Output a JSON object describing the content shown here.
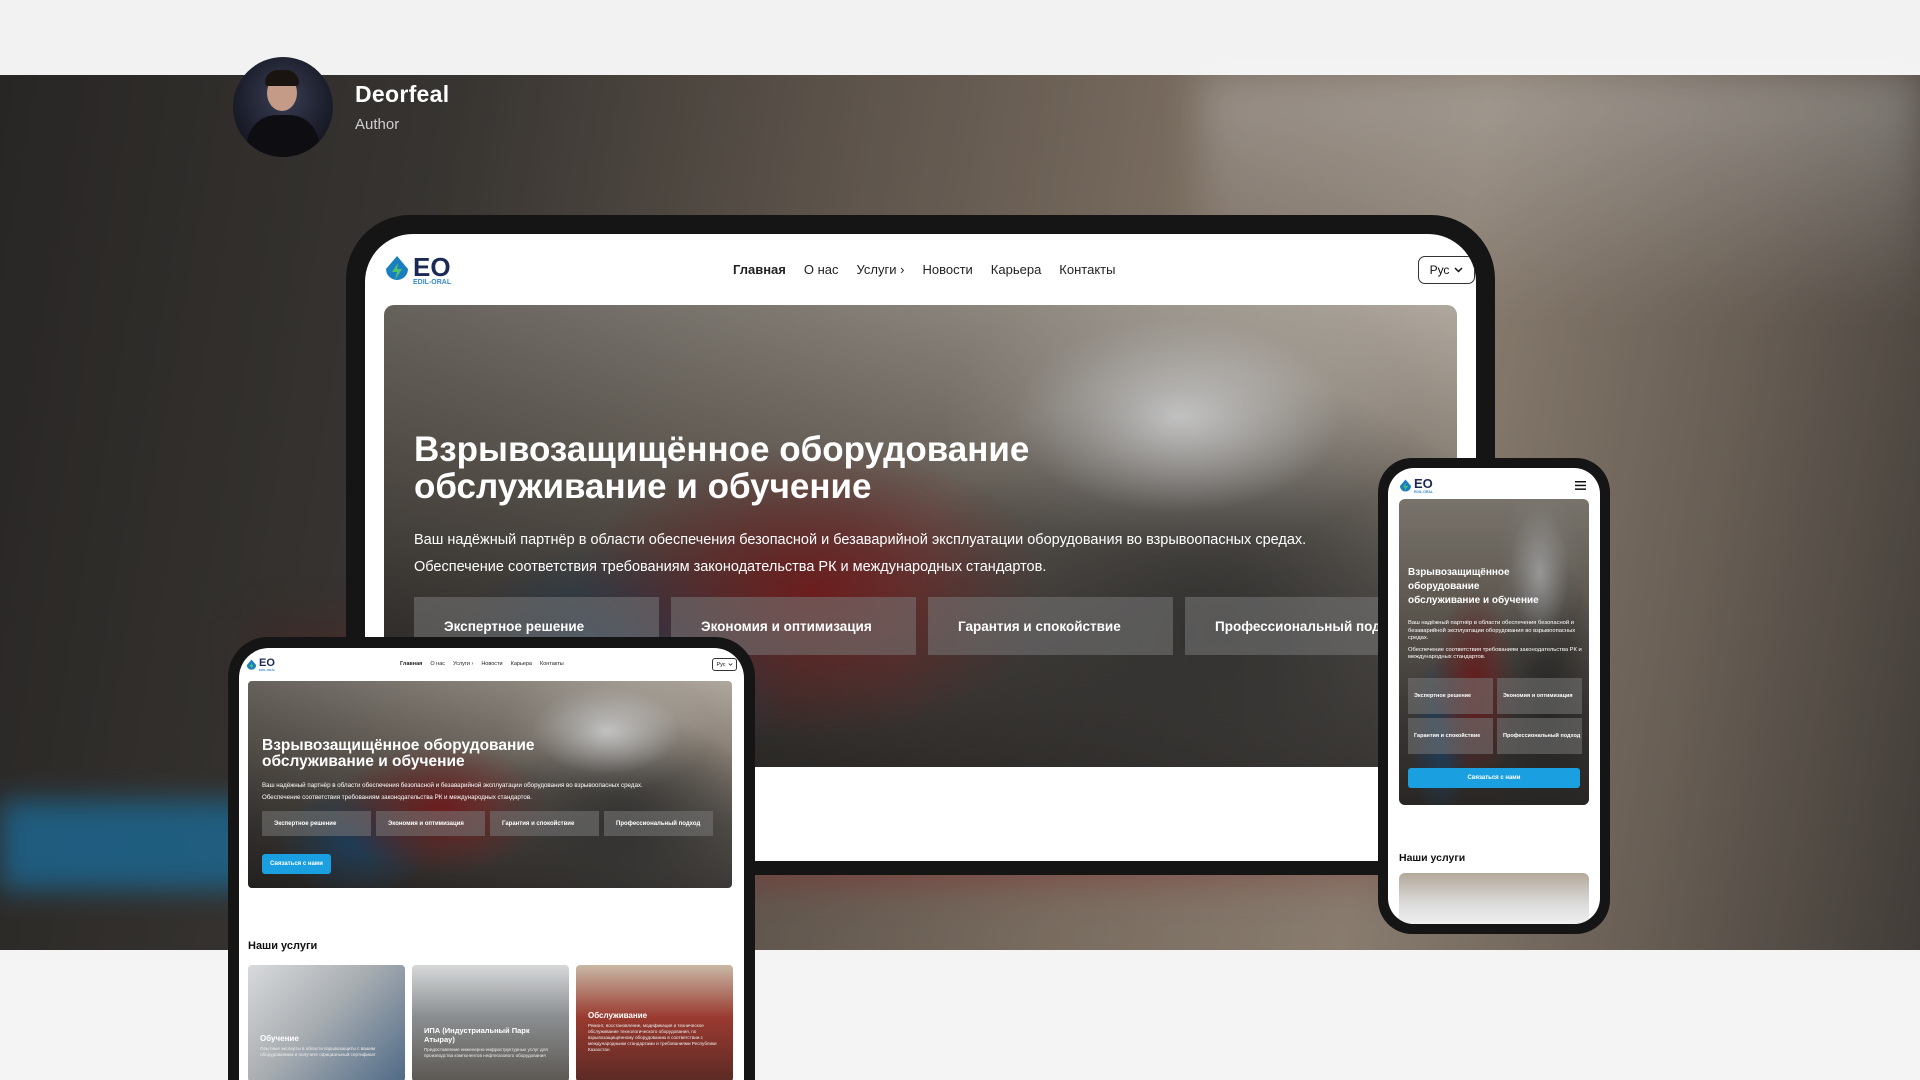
{
  "author": {
    "name": "Deorfeal",
    "role": "Author"
  },
  "site": {
    "logo_text": "EO",
    "logo_sub": "EDIL-ORAL",
    "nav": [
      "Главная",
      "О нас",
      "Услуги",
      "Новости",
      "Карьера",
      "Контакты"
    ],
    "services_chevron": "›",
    "lang": "Рус",
    "hero_title_1": "Взрывозащищённое оборудование",
    "hero_title_2": "обслуживание и обучение",
    "hero_text_1": "Ваш надёжный партнёр в области обеспечения безопасной и безаварийной эксплуатации оборудования во взрывоопасных средах.",
    "hero_text_2": "Обеспечение соответствия требованиям законодательства РК и международных стандартов.",
    "chips": [
      "Экспертное решение",
      "Экономия и оптимизация",
      "Гарантия и спокойствие",
      "Профессиональный подход"
    ],
    "cta": "Связаться с нами",
    "services_title": "Наши услуги",
    "cards": [
      {
        "title": "Обучение",
        "desc": "Опытные эксперты в области взрывозащиты с вашим оборудованием и получите официальный сертификат"
      },
      {
        "title": "ИПА (Индустриальный Парк Атырау)",
        "desc": "Предоставление инженерно-инфраструктурных услуг для производства компонентов нефтегазового оборудования"
      },
      {
        "title": "Обслуживание",
        "desc": "Ремонт, восстановление, модификация и техническое обслуживание технологического оборудования, по взрывозащищённому оборудованию в соответствии с международными стандартами и требованиями Республики Казахстан"
      }
    ]
  },
  "colors": {
    "accent": "#1aa0e0",
    "logo_blue": "#1a7fc1",
    "logo_dark": "#1b2a55"
  },
  "icons": {
    "logo": "lightning-drop-icon",
    "chevron": "chevron-down-icon",
    "menu": "hamburger-menu-icon"
  }
}
